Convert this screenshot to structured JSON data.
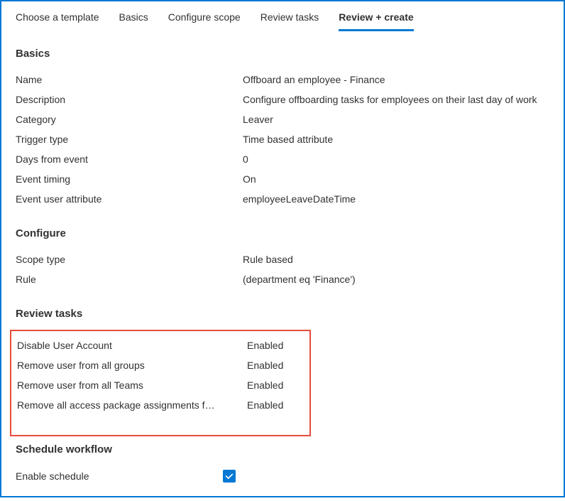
{
  "tabs": {
    "choose_template": "Choose a template",
    "basics": "Basics",
    "configure_scope": "Configure scope",
    "review_tasks": "Review tasks",
    "review_create": "Review + create"
  },
  "sections": {
    "basics": {
      "title": "Basics",
      "rows": {
        "name": {
          "label": "Name",
          "value": "Offboard an employee - Finance"
        },
        "description": {
          "label": "Description",
          "value": "Configure offboarding tasks for employees on their last day of work"
        },
        "category": {
          "label": "Category",
          "value": "Leaver"
        },
        "trigger_type": {
          "label": "Trigger type",
          "value": "Time based attribute"
        },
        "days_from_event": {
          "label": "Days from event",
          "value": "0"
        },
        "event_timing": {
          "label": "Event timing",
          "value": "On"
        },
        "event_user_attribute": {
          "label": "Event user attribute",
          "value": "employeeLeaveDateTime"
        }
      }
    },
    "configure": {
      "title": "Configure",
      "rows": {
        "scope_type": {
          "label": "Scope type",
          "value": "Rule based"
        },
        "rule": {
          "label": "Rule",
          "value": " (department eq 'Finance')"
        }
      }
    },
    "review_tasks": {
      "title": "Review tasks",
      "tasks": [
        {
          "label": "Disable User Account",
          "value": "Enabled"
        },
        {
          "label": "Remove user from all groups",
          "value": "Enabled"
        },
        {
          "label": "Remove user from all Teams",
          "value": "Enabled"
        },
        {
          "label": "Remove all access package assignments f…",
          "value": "Enabled"
        }
      ]
    },
    "schedule": {
      "title": "Schedule workflow",
      "enable_label": "Enable schedule"
    }
  }
}
